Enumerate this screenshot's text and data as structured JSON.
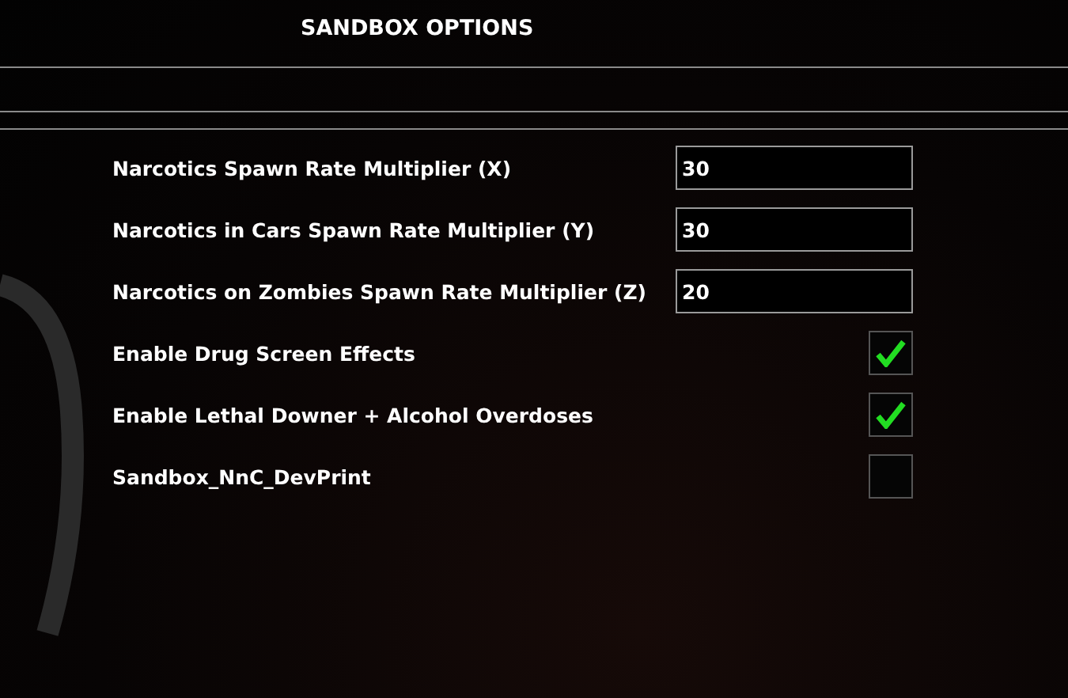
{
  "window": {
    "title": "SANDBOX OPTIONS"
  },
  "options": [
    {
      "kind": "number",
      "label": "Narcotics Spawn Rate Multiplier (X)",
      "value": "30"
    },
    {
      "kind": "number",
      "label": "Narcotics in Cars Spawn Rate Multiplier (Y)",
      "value": "30"
    },
    {
      "kind": "number",
      "label": "Narcotics on Zombies Spawn Rate Multiplier (Z)",
      "value": "20"
    },
    {
      "kind": "checkbox",
      "label": "Enable Drug Screen Effects",
      "checked": true
    },
    {
      "kind": "checkbox",
      "label": "Enable Lethal Downer + Alcohol Overdoses",
      "checked": true
    },
    {
      "kind": "checkbox",
      "label": "Sandbox_NnC_DevPrint",
      "checked": false
    }
  ]
}
